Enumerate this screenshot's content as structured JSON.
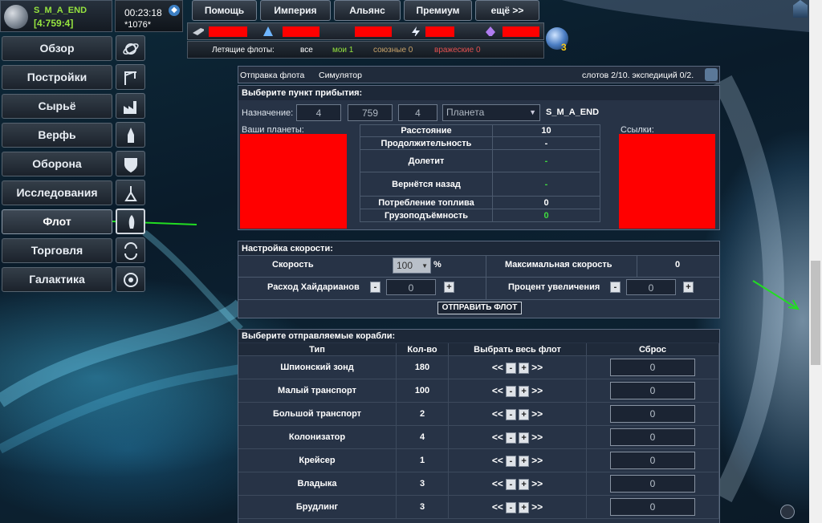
{
  "player": {
    "name": "S_M_A_END",
    "coords": "[4:759:4]"
  },
  "clock": {
    "time": "00:23:18",
    "counter": "*1076*"
  },
  "topnav": [
    "Помощь",
    "Империя",
    "Альянс",
    "Премиум",
    "ещё >>"
  ],
  "resources": {
    "icons": [
      "metal-icon",
      "crystal-icon",
      "deuterium-icon",
      "energy-icon",
      "darkmatter-icon"
    ]
  },
  "fleets": {
    "label": "Летящие флоты:",
    "all": "все",
    "mine": "мои 1",
    "allied": "союзные 0",
    "hostile": "вражеские 0"
  },
  "notifications": {
    "count": "3"
  },
  "menu": [
    {
      "label": "Обзор",
      "icon": "planet-icon"
    },
    {
      "label": "Постройки",
      "icon": "crane-icon"
    },
    {
      "label": "Сырьё",
      "icon": "factory-icon"
    },
    {
      "label": "Верфь",
      "icon": "shipyard-icon"
    },
    {
      "label": "Оборона",
      "icon": "shield-icon"
    },
    {
      "label": "Исследования",
      "icon": "research-icon"
    },
    {
      "label": "Флот",
      "icon": "rocket-icon"
    },
    {
      "label": "Торговля",
      "icon": "trade-icon"
    },
    {
      "label": "Галактика",
      "icon": "galaxy-icon"
    }
  ],
  "tabs": {
    "send": "Отправка флота",
    "simulator": "Симулятор",
    "slots": "слотов 2/10. экспедиций 0/2."
  },
  "arrival": {
    "header": "Выберите пункт прибытия:",
    "dest_label": "Назначение:",
    "galaxy": "4",
    "system": "759",
    "position": "4",
    "type": "Планета",
    "target_name": "S_M_A_END",
    "your_planets": "Ваши планеты:",
    "links": "Ссылки:",
    "rows": [
      {
        "label": "Расстояние",
        "value": "10"
      },
      {
        "label": "Продолжительность",
        "value": "-"
      },
      {
        "label": "Долетит",
        "value": "-"
      },
      {
        "label": "Вернётся назад",
        "value": "-"
      },
      {
        "label": "Потребление топлива",
        "value": "0"
      },
      {
        "label": "Грузоподъёмность",
        "value": "0"
      }
    ]
  },
  "speed": {
    "header": "Настройка скорости:",
    "speed_label": "Скорость",
    "speed_value": "100",
    "percent": "%",
    "max_label": "Максимальная скорость",
    "max_value": "0",
    "hydarian_label": "Расход Хайдарианов",
    "hydarian_value": "0",
    "increase_label": "Процент увеличения",
    "increase_value": "0",
    "send_button": "ОТПРАВИТЬ ФЛОТ"
  },
  "ships": {
    "header": "Выберите отправляемые корабли:",
    "columns": [
      "Тип",
      "Кол-во",
      "Выбрать весь флот",
      "Сброс"
    ],
    "rows": [
      {
        "name": "Шпионский зонд",
        "count": "180",
        "input": "0"
      },
      {
        "name": "Малый транспорт",
        "count": "100",
        "input": "0"
      },
      {
        "name": "Большой транспорт",
        "count": "2",
        "input": "0"
      },
      {
        "name": "Колонизатор",
        "count": "4",
        "input": "0"
      },
      {
        "name": "Крейсер",
        "count": "1",
        "input": "0"
      },
      {
        "name": "Владыка",
        "count": "3",
        "input": "0"
      },
      {
        "name": "Брудлинг",
        "count": "3",
        "input": "0"
      }
    ]
  },
  "accent": "#95e33f"
}
